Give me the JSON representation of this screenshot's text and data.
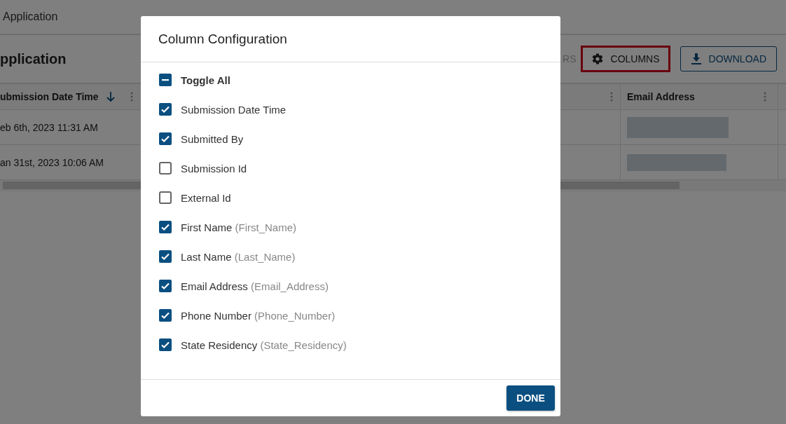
{
  "breadcrumb": "Application",
  "page_title": "pplication",
  "toolbar": [
    {
      "label": "RS",
      "kind": "faded",
      "highlighted": false
    },
    {
      "label": "COLUMNS",
      "kind": "columns",
      "highlighted": true
    },
    {
      "label": "DOWNLOAD",
      "kind": "download",
      "highlighted": false
    }
  ],
  "table": {
    "columns": [
      {
        "label": "ubmission Date Time",
        "sorted_descending": true
      },
      {
        "label": "Email Address",
        "sorted_descending": false
      }
    ],
    "rows": [
      {
        "submission_date_time": "eb 6th, 2023 11:31 AM"
      },
      {
        "submission_date_time": "an 31st, 2023 10:06 AM"
      }
    ]
  },
  "dialog": {
    "title": "Column Configuration",
    "toggle_all": {
      "label": "Toggle All",
      "indeterminate": true
    },
    "options": [
      {
        "label": "Submission Date Time",
        "checked": true
      },
      {
        "label": "Submitted By",
        "checked": true
      },
      {
        "label": "Submission Id",
        "checked": false
      },
      {
        "label": "External Id",
        "checked": false
      },
      {
        "label": "First Name",
        "field": "(First_Name)",
        "checked": true
      },
      {
        "label": "Last Name",
        "field": "(Last_Name)",
        "checked": true
      },
      {
        "label": "Email Address",
        "field": "(Email_Address)",
        "checked": true
      },
      {
        "label": "Phone Number",
        "field": "(Phone_Number)",
        "checked": true
      },
      {
        "label": "State Residency",
        "field": "(State_Residency)",
        "checked": true
      }
    ],
    "button": "DONE"
  }
}
